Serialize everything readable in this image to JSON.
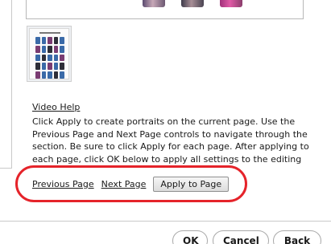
{
  "help": {
    "link_label": "Video Help",
    "instructions": "Click Apply to create portraits on the current page. Use the Previous Page and Next Page controls to navigate through the section. Be sure to click Apply for each page. After applying to each page, click OK below to apply all settings to the editing page."
  },
  "navigation": {
    "previous_label": "Previous Page",
    "next_label": "Next Page",
    "apply_label": "Apply to Page"
  },
  "footer": {
    "ok_label": "OK",
    "cancel_label": "Cancel",
    "back_label": "Back"
  },
  "colors": {
    "highlight": "#e5232a"
  }
}
